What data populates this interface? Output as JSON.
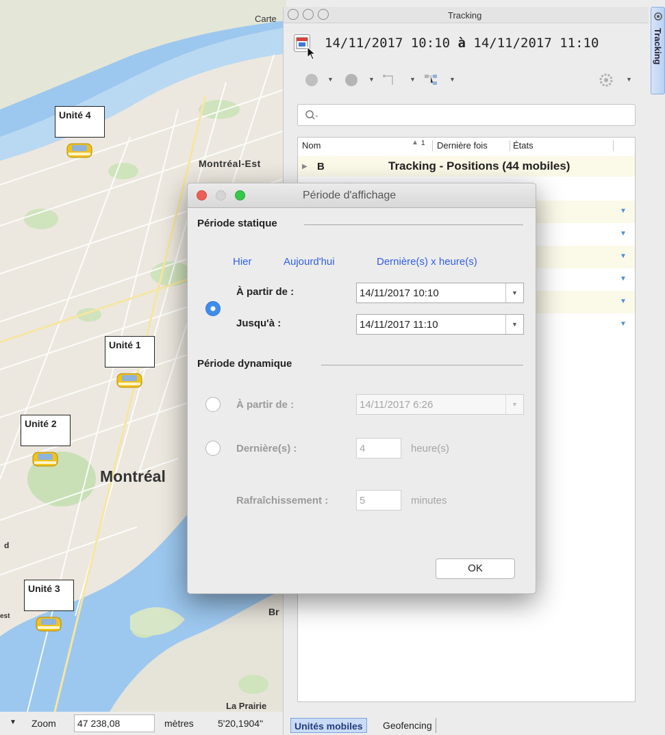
{
  "map": {
    "title": "Carte",
    "labels": {
      "montreal_est": "Montréal-Est",
      "montreal": "Montréal",
      "br": "Br",
      "la_prairie": "La Prairie",
      "est": "est",
      "d": "d"
    },
    "units": [
      {
        "name": "Unité 4"
      },
      {
        "name": "Unité 1"
      },
      {
        "name": "Unité 2"
      },
      {
        "name": "Unité 3"
      }
    ],
    "status": {
      "zoom_label": "Zoom",
      "zoom_value": "47 238,08",
      "units_label": "mètres",
      "coord": "5'20,1904\""
    }
  },
  "tracking": {
    "title": "Tracking",
    "period": {
      "from": "14/11/2017 10:10",
      "sep": "à",
      "to": "14/11/2017 11:10"
    },
    "table": {
      "col_nom": "Nom",
      "sort_indicator": "1",
      "col_derniere_fois": "Dernière fois",
      "col_etats": "États",
      "group_key": "B",
      "group_label": "Tracking - Positions (44 mobiles)"
    },
    "tabs": [
      {
        "label": "Unités mobiles"
      },
      {
        "label": "Geofencing"
      }
    ],
    "side_tab": "Tracking",
    "colors": {
      "accent": "#3e8dea",
      "link": "#2f5ee8",
      "close": "#ec5f57",
      "maximize": "#35c84a"
    }
  },
  "dialog": {
    "title": "Période d'affichage",
    "static_section": "Période statique",
    "quick_links": {
      "yesterday": "Hier",
      "today": "Aujourd'hui",
      "last_hours": "Dernière(s) x heure(s)"
    },
    "static_from_label": "À partir de :",
    "static_from_value": "14/11/2017 10:10",
    "static_to_label": "Jusqu'à :",
    "static_to_value": "14/11/2017 11:10",
    "dynamic_section": "Période dynamique",
    "dynamic_from_label": "À partir de :",
    "dynamic_from_value": "14/11/2017 6:26",
    "last_label": "Dernière(s) :",
    "last_value": "4",
    "last_unit": "heure(s)",
    "refresh_label": "Rafraîchissement :",
    "refresh_value": "5",
    "refresh_unit": "minutes",
    "ok": "OK"
  }
}
